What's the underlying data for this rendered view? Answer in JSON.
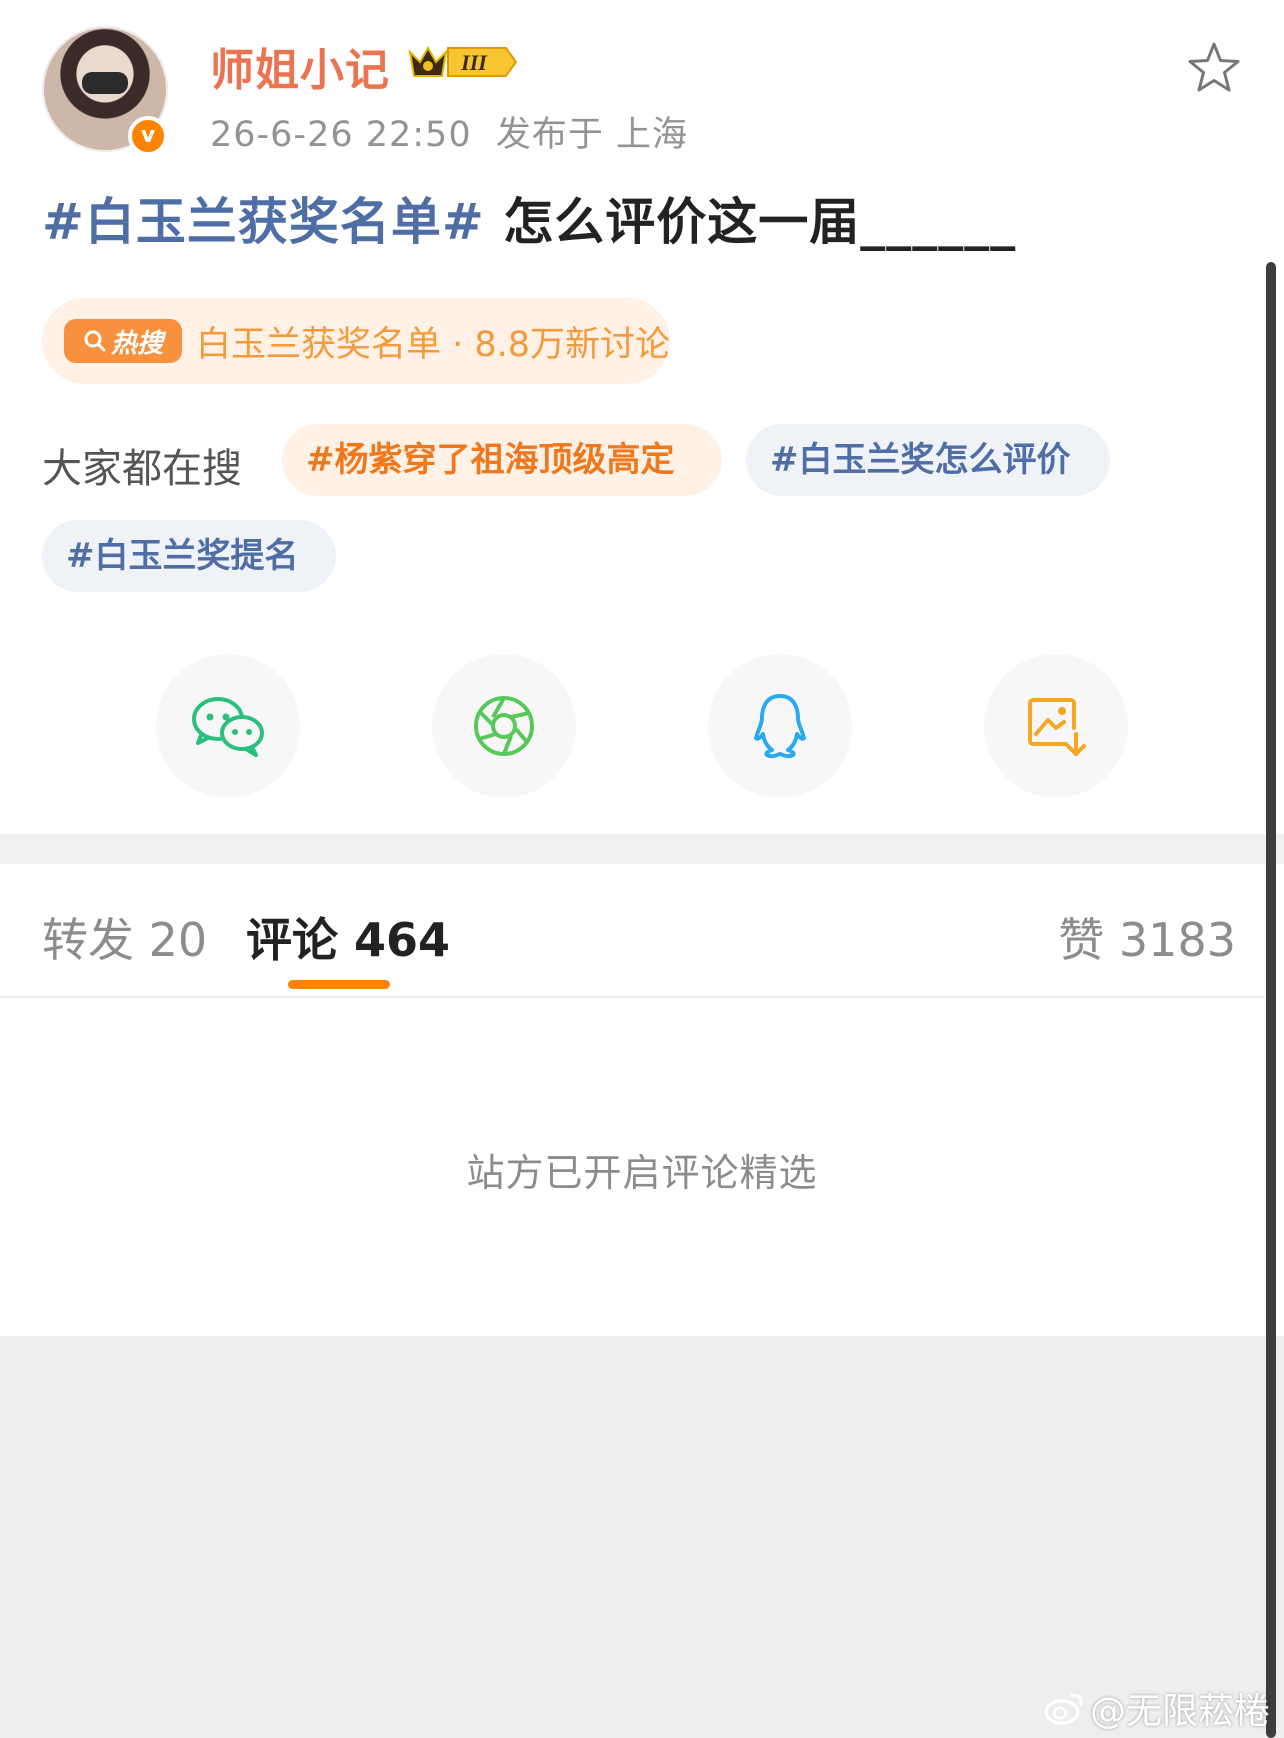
{
  "header": {
    "username": "师姐小记",
    "level_badge": "III",
    "timestamp": "26-6-26 22:50",
    "location": "发布于 上海",
    "verified_icon": "v",
    "favorite_icon": "star-outline-icon"
  },
  "post": {
    "hashtag": "#白玉兰获奖名单#",
    "text": " 怎么评价这一届______"
  },
  "hot_search": {
    "badge_icon": "search-icon",
    "badge_label": "热搜",
    "text": "白玉兰获奖名单 · 8.8万新讨论"
  },
  "everyone_searching": {
    "label": "大家都在搜",
    "chips": [
      {
        "text": "#杨紫穿了祖海顶级高定",
        "style": "orange"
      },
      {
        "text": "#白玉兰奖怎么评价",
        "style": "blue"
      },
      {
        "text": "#白玉兰奖提名",
        "style": "blue"
      }
    ]
  },
  "share_buttons": [
    {
      "icon": "wechat-icon",
      "color": "#2bbf7f"
    },
    {
      "icon": "moments-icon",
      "color": "#58c85b"
    },
    {
      "icon": "qq-icon",
      "color": "#2aa8f0"
    },
    {
      "icon": "save-image-icon",
      "color": "#f5a623"
    }
  ],
  "tabs": {
    "repost": "转发 20",
    "comment": "评论 464",
    "like": "赞 3183"
  },
  "notice": "站方已开启评论精选",
  "watermark": "@无限菘棬",
  "colors": {
    "accent": "#ff8200",
    "username": "#eb7350",
    "hashtag": "#4e6ea5"
  }
}
